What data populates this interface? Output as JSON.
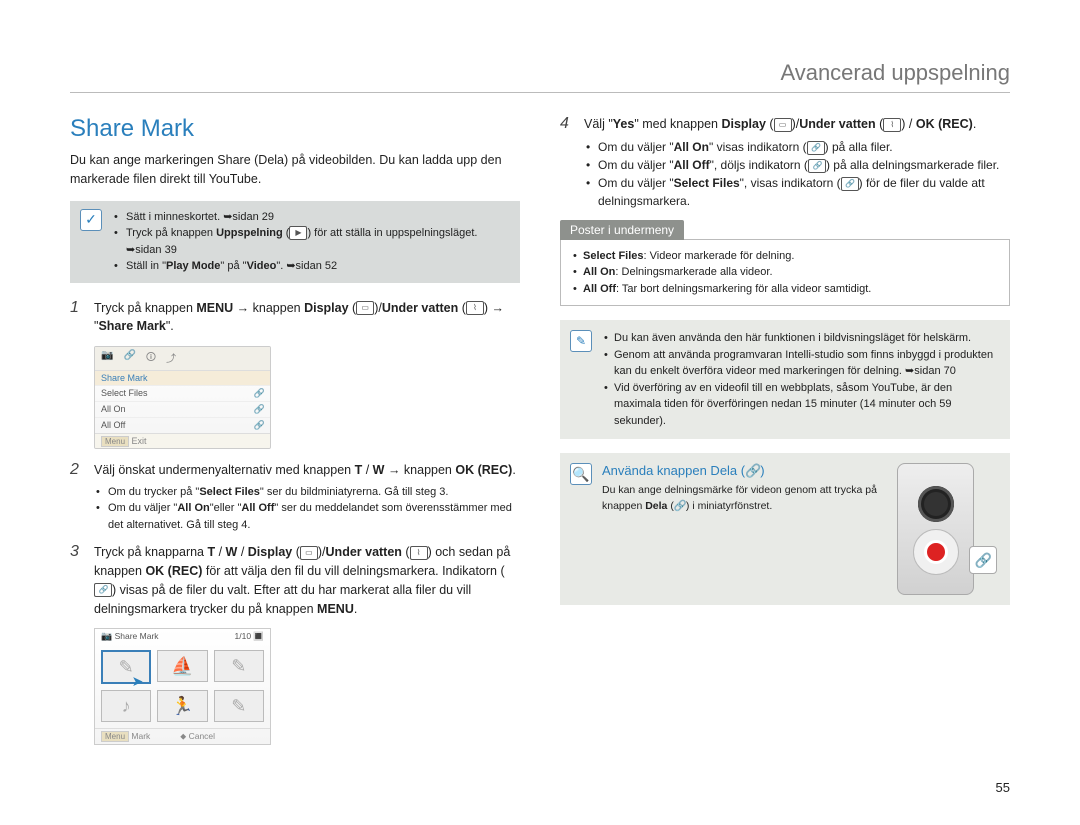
{
  "header": {
    "title": "Avancerad uppspelning"
  },
  "section_title": "Share Mark",
  "intro": "Du kan ange markeringen Share (Dela) på videobilden. Du kan ladda upp den markerade filen direkt till YouTube.",
  "prereq": {
    "items": [
      "Sätt i minneskortet. ➥sidan 29",
      "Tryck på knappen Uppspelning ( ▶ ) för att ställa in uppspelningsläget. ➥sidan 39",
      "Ställ in \"Play Mode\" på \"Video\". ➥sidan 52"
    ]
  },
  "steps_left": [
    {
      "num": "1",
      "body_parts": [
        "Tryck på knappen ",
        "MENU",
        " → knappen ",
        "Display",
        " (📺)/",
        "Under vatten",
        " (💧) → \"",
        "Share Mark",
        "\"."
      ]
    },
    {
      "num": "2",
      "body_parts": [
        "Välj önskat undermenyalternativ med knappen ",
        "T",
        " / ",
        "W",
        " → knappen ",
        "OK (REC)",
        "."
      ],
      "sub": [
        "Om du trycker på \"Select Files\" ser du bildminiatyrerna. Gå till steg 3.",
        "Om du väljer \"All On\" eller \"All Off\" ser du meddelandet som överensstämmer med det alternativet. Gå till steg 4."
      ]
    },
    {
      "num": "3",
      "body_parts": [
        "Tryck på knapparna ",
        "T",
        " / ",
        "W",
        " / ",
        "Display",
        " (📺)/",
        "Under vatten",
        " (💧) och sedan på knappen ",
        "OK (REC)",
        " för att välja den fil du vill delningsmarkera. Indikatorn (🔗) visas på de filer du valt. Efter att du har markerat alla filer du vill delningsmarkera trycker du på knappen ",
        "MENU",
        "."
      ]
    }
  ],
  "step4": {
    "num": "4",
    "body_parts": [
      "Välj \"",
      "Yes",
      "\" med knappen ",
      "Display",
      " (📺)/",
      "Under vatten",
      " (💧) / ",
      "OK (REC)",
      "."
    ],
    "sub": [
      "Om du väljer \"All On\" visas indikatorn (🔗) på alla filer.",
      "Om du väljer \"All Off\", döljs indikatorn (🔗) på alla delningsmarkerade filer.",
      "Om du väljer \"Select Files\", visas indikatorn (🔗) för de filer du valde att delningsmarkera."
    ]
  },
  "submenu": {
    "title": "Poster i undermeny",
    "items": [
      {
        "b": "Select Files",
        "t": ": Videor markerade för delning."
      },
      {
        "b": "All On",
        "t": ": Delningsmarkerade alla videor."
      },
      {
        "b": "All Off",
        "t": ": Tar bort delningsmarkering för alla videor samtidigt."
      }
    ]
  },
  "tips": {
    "items": [
      "Du kan även använda den här funktionen i bildvisningsläget för helskärm.",
      "Genom att använda programvaran Intelli-studio som finns inbyggd i produkten kan du enkelt överföra videor med markeringen för delning. ➥sidan 70",
      "Vid överföring av en videofil till en webbplats, såsom YouTube, är den maximala tiden för överföringen nedan 15 minuter (14 minuter och 59 sekunder)."
    ]
  },
  "dela": {
    "title": "Använda knappen Dela (🔗)",
    "text": "Du kan ange delningsmärke för videon genom att trycka på knappen Dela (🔗) i miniatyrfönstret."
  },
  "menu_fig": {
    "title": "Share Mark",
    "rows": [
      "Select Files",
      "All On",
      "All Off"
    ],
    "exit": "Exit"
  },
  "thumb_fig": {
    "title": "Share Mark",
    "count": "1/10",
    "mark": "Mark",
    "cancel": "Cancel"
  },
  "page_number": "55",
  "icons": {
    "display": "📺",
    "underwater": "💧",
    "link": "🔗",
    "play": "▶",
    "check": "✓",
    "edit": "✎",
    "magnify": "🔍",
    "menu": "Menu"
  }
}
